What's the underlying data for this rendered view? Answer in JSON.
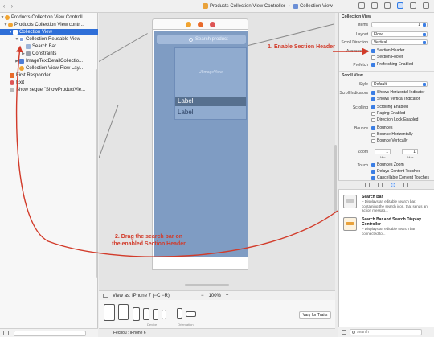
{
  "jumpbar": {
    "path": [
      "Products Collection View Controller",
      "Collection View"
    ]
  },
  "navigator": {
    "rows": [
      {
        "label": "Products Collection View Controll...",
        "icon": "scene-icon"
      },
      {
        "label": "Products Collection View contr...",
        "icon": "view-controller-icon"
      },
      {
        "label": "Collection View",
        "icon": "collection-view-icon"
      },
      {
        "label": "Collection Reusable View",
        "icon": "reusable-view-icon"
      },
      {
        "label": "Search Bar",
        "icon": "search-bar-icon"
      },
      {
        "label": "Constraints",
        "icon": "constraints-icon"
      },
      {
        "label": "ImageTextDetailCollectio...",
        "icon": "cell-icon"
      },
      {
        "label": "Collection View Flow Lay...",
        "icon": "flow-layout-icon"
      },
      {
        "label": "First Responder",
        "icon": "first-responder-icon"
      },
      {
        "label": "Exit",
        "icon": "exit-icon"
      },
      {
        "label": "Show segue \"ShowProductVie...",
        "icon": "segue-icon"
      }
    ]
  },
  "canvas": {
    "search_placeholder": "Search product",
    "image_view_label": "UIImageView",
    "cell_label_1": "Label",
    "cell_label_2": "Label",
    "view_as": "View as: iPhone 7 (−C −R)",
    "zoom_minus": "−",
    "zoom_level": "100%",
    "zoom_plus": "+",
    "device_caption": "Device",
    "orientation_caption": "Orientation",
    "vary_button": "Vary for Traits",
    "status_text": "Fechou : iPhone 6"
  },
  "inspector": {
    "section_collection_view": "Collection View",
    "items_label": "Items",
    "items_value": "1",
    "layout_label": "Layout",
    "layout_value": "Flow",
    "scroll_dir_label": "Scroll Direction",
    "scroll_dir_value": "Vertical",
    "accessories_label": "Accessories",
    "section_header": "Section Header",
    "section_footer": "Section Footer",
    "prefetch_label": "Prefetch",
    "prefetch_value": "Prefetching Enabled",
    "section_scroll_view": "Scroll View",
    "style_label": "Style",
    "style_value": "Default",
    "scroll_indicators_label": "Scroll Indicators",
    "shows_horizontal": "Shows Horizontal Indicator",
    "shows_vertical": "Shows Vertical Indicator",
    "scrolling_label": "Scrolling",
    "scrolling_enabled": "Scrolling Enabled",
    "paging_enabled": "Paging Enabled",
    "direction_lock": "Direction Lock Enabled",
    "bounce_label": "Bounce",
    "bounces": "Bounces",
    "bounce_horizontally": "Bounce Horizontally",
    "bounce_vertically": "Bounce Vertically",
    "zoom_label": "Zoom",
    "zoom_min": "1",
    "zoom_max": "1",
    "min_caption": "Min",
    "max_caption": "Max",
    "touch_label": "Touch",
    "bounces_zoom": "Bounces Zoom",
    "delays_content_touches": "Delays Content Touches",
    "cancellable_content_touches": "Cancellable Content Touches"
  },
  "library": {
    "items": [
      {
        "title": "Search Bar",
        "desc": "– Displays an editable search bar, containing the search icon, that sends an action messag..."
      },
      {
        "title": "Search Bar and Search Display Controller",
        "desc": "– Displays an editable search bar connected to..."
      }
    ],
    "search_placeholder": "search"
  },
  "annotations": {
    "step1": "1. Enable Section Header",
    "step2_line1": "2. Drag the search bar on",
    "step2_line2": "the enabled Section Header",
    "color": "#d23b2a"
  },
  "colors": {
    "selection": "#2f6fd8",
    "collection_view_bg": "#7f9cc3",
    "accent": "#3b7ee4"
  }
}
